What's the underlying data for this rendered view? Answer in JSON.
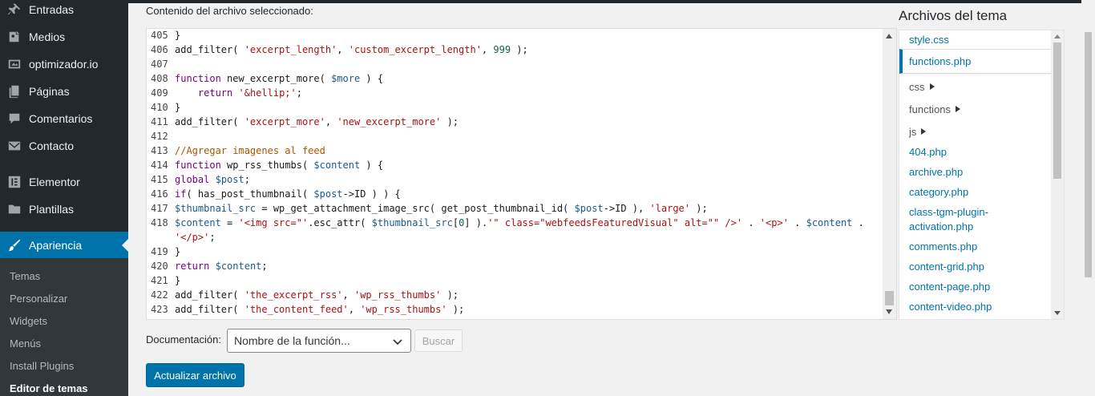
{
  "sidebar": {
    "menu": [
      {
        "label": "Entradas",
        "icon": "pushpin-icon"
      },
      {
        "label": "Medios",
        "icon": "media-icon"
      },
      {
        "label": "optimizador.io",
        "icon": "optimizer-icon"
      },
      {
        "label": "Páginas",
        "icon": "pages-icon"
      },
      {
        "label": "Comentarios",
        "icon": "comments-icon"
      },
      {
        "label": "Contacto",
        "icon": "mail-icon"
      },
      {
        "label": "Elementor",
        "icon": "elementor-icon"
      },
      {
        "label": "Plantillas",
        "icon": "folder-icon"
      },
      {
        "label": "Apariencia",
        "icon": "brush-icon",
        "active": true
      }
    ],
    "submenu": [
      {
        "label": "Temas"
      },
      {
        "label": "Personalizar"
      },
      {
        "label": "Widgets"
      },
      {
        "label": "Menús"
      },
      {
        "label": "Install Plugins"
      },
      {
        "label": "Editor de temas",
        "current": true
      }
    ]
  },
  "editor": {
    "label": "Contenido del archivo seleccionado:",
    "lines": [
      {
        "num": "405",
        "code": "}"
      },
      {
        "num": "406",
        "code": "add_filter( 'excerpt_length', 'custom_excerpt_length', 999 );"
      },
      {
        "num": "407",
        "code": ""
      },
      {
        "num": "408",
        "code": "function new_excerpt_more( $more ) {"
      },
      {
        "num": "409",
        "code": "    return '&hellip;';"
      },
      {
        "num": "410",
        "code": "}"
      },
      {
        "num": "411",
        "code": "add_filter( 'excerpt_more', 'new_excerpt_more' );"
      },
      {
        "num": "412",
        "code": ""
      },
      {
        "num": "413",
        "code": "//Agregar imagenes al feed"
      },
      {
        "num": "414",
        "code": "function wp_rss_thumbs( $content ) {"
      },
      {
        "num": "415",
        "code": "global $post;"
      },
      {
        "num": "416",
        "code": "if( has_post_thumbnail( $post->ID ) ) {"
      },
      {
        "num": "417",
        "code": "$thumbnail_src = wp_get_attachment_image_src( get_post_thumbnail_id( $post->ID ), 'large' );"
      },
      {
        "num": "418",
        "code": "$content = '<img src=\"'.esc_attr( $thumbnail_src[0] ).'\" class=\"webfeedsFeaturedVisual\" alt=\"\" />' . '<p>' . $content ."
      },
      {
        "num": "",
        "code": "'</p>';"
      },
      {
        "num": "419",
        "code": "}"
      },
      {
        "num": "420",
        "code": "return $content;"
      },
      {
        "num": "421",
        "code": "}"
      },
      {
        "num": "422",
        "code": "add_filter( 'the_excerpt_rss', 'wp_rss_thumbs' );"
      },
      {
        "num": "423",
        "code": "add_filter( 'the_content_feed', 'wp_rss_thumbs' );"
      }
    ]
  },
  "theme_files": {
    "title": "Archivos del tema",
    "items": [
      {
        "label": "style.css",
        "type": "file"
      },
      {
        "label": "functions.php",
        "type": "file",
        "selected": true
      },
      {
        "label": "css",
        "type": "folder"
      },
      {
        "label": "functions",
        "type": "folder"
      },
      {
        "label": "js",
        "type": "folder"
      },
      {
        "label": "404.php",
        "type": "file"
      },
      {
        "label": "archive.php",
        "type": "file"
      },
      {
        "label": "category.php",
        "type": "file"
      },
      {
        "label": "class-tgm-plugin-",
        "type": "file"
      },
      {
        "label": "activation.php",
        "type": "file"
      },
      {
        "label": "comments.php",
        "type": "file"
      },
      {
        "label": "content-grid.php",
        "type": "file"
      },
      {
        "label": "content-page.php",
        "type": "file"
      },
      {
        "label": "content-video.php",
        "type": "file"
      }
    ]
  },
  "documentation": {
    "label": "Documentación:",
    "select_value": "Nombre de la función...",
    "search_label": "Buscar"
  },
  "update_button": "Actualizar archivo",
  "colors": {
    "sidebar_bg": "#23282d",
    "accent": "#0073aa",
    "link": "#0073aa"
  }
}
